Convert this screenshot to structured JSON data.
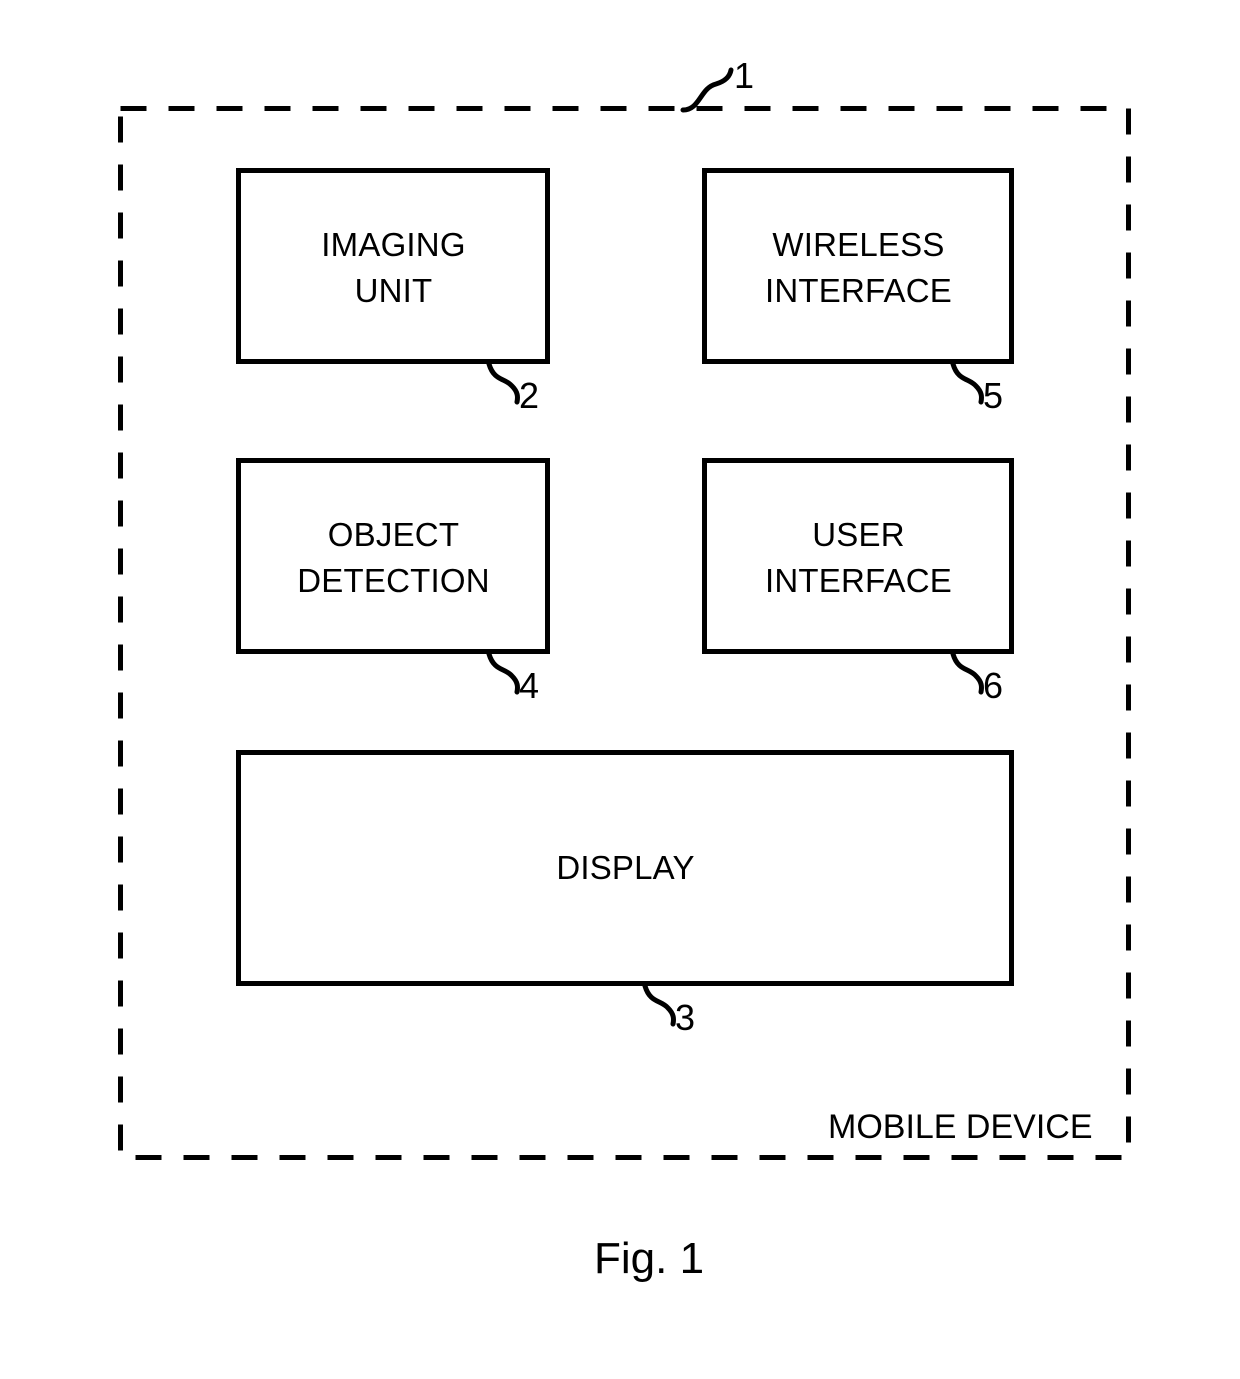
{
  "figure": {
    "caption": "Fig. 1",
    "enclosure": {
      "label": "MOBILE DEVICE",
      "reference": "1",
      "border_style": "dashed",
      "color": "#000000"
    },
    "blocks": [
      {
        "id": "imaging-unit",
        "label": "IMAGING\nUNIT",
        "reference": "2"
      },
      {
        "id": "wireless-interface",
        "label": "WIRELESS\nINTERFACE",
        "reference": "5"
      },
      {
        "id": "object-detection",
        "label": "OBJECT\nDETECTION",
        "reference": "4"
      },
      {
        "id": "user-interface",
        "label": "USER\nINTERFACE",
        "reference": "6"
      },
      {
        "id": "display",
        "label": "DISPLAY",
        "reference": "3"
      }
    ]
  },
  "colors": {
    "ink": "#000000",
    "paper": "#ffffff"
  }
}
